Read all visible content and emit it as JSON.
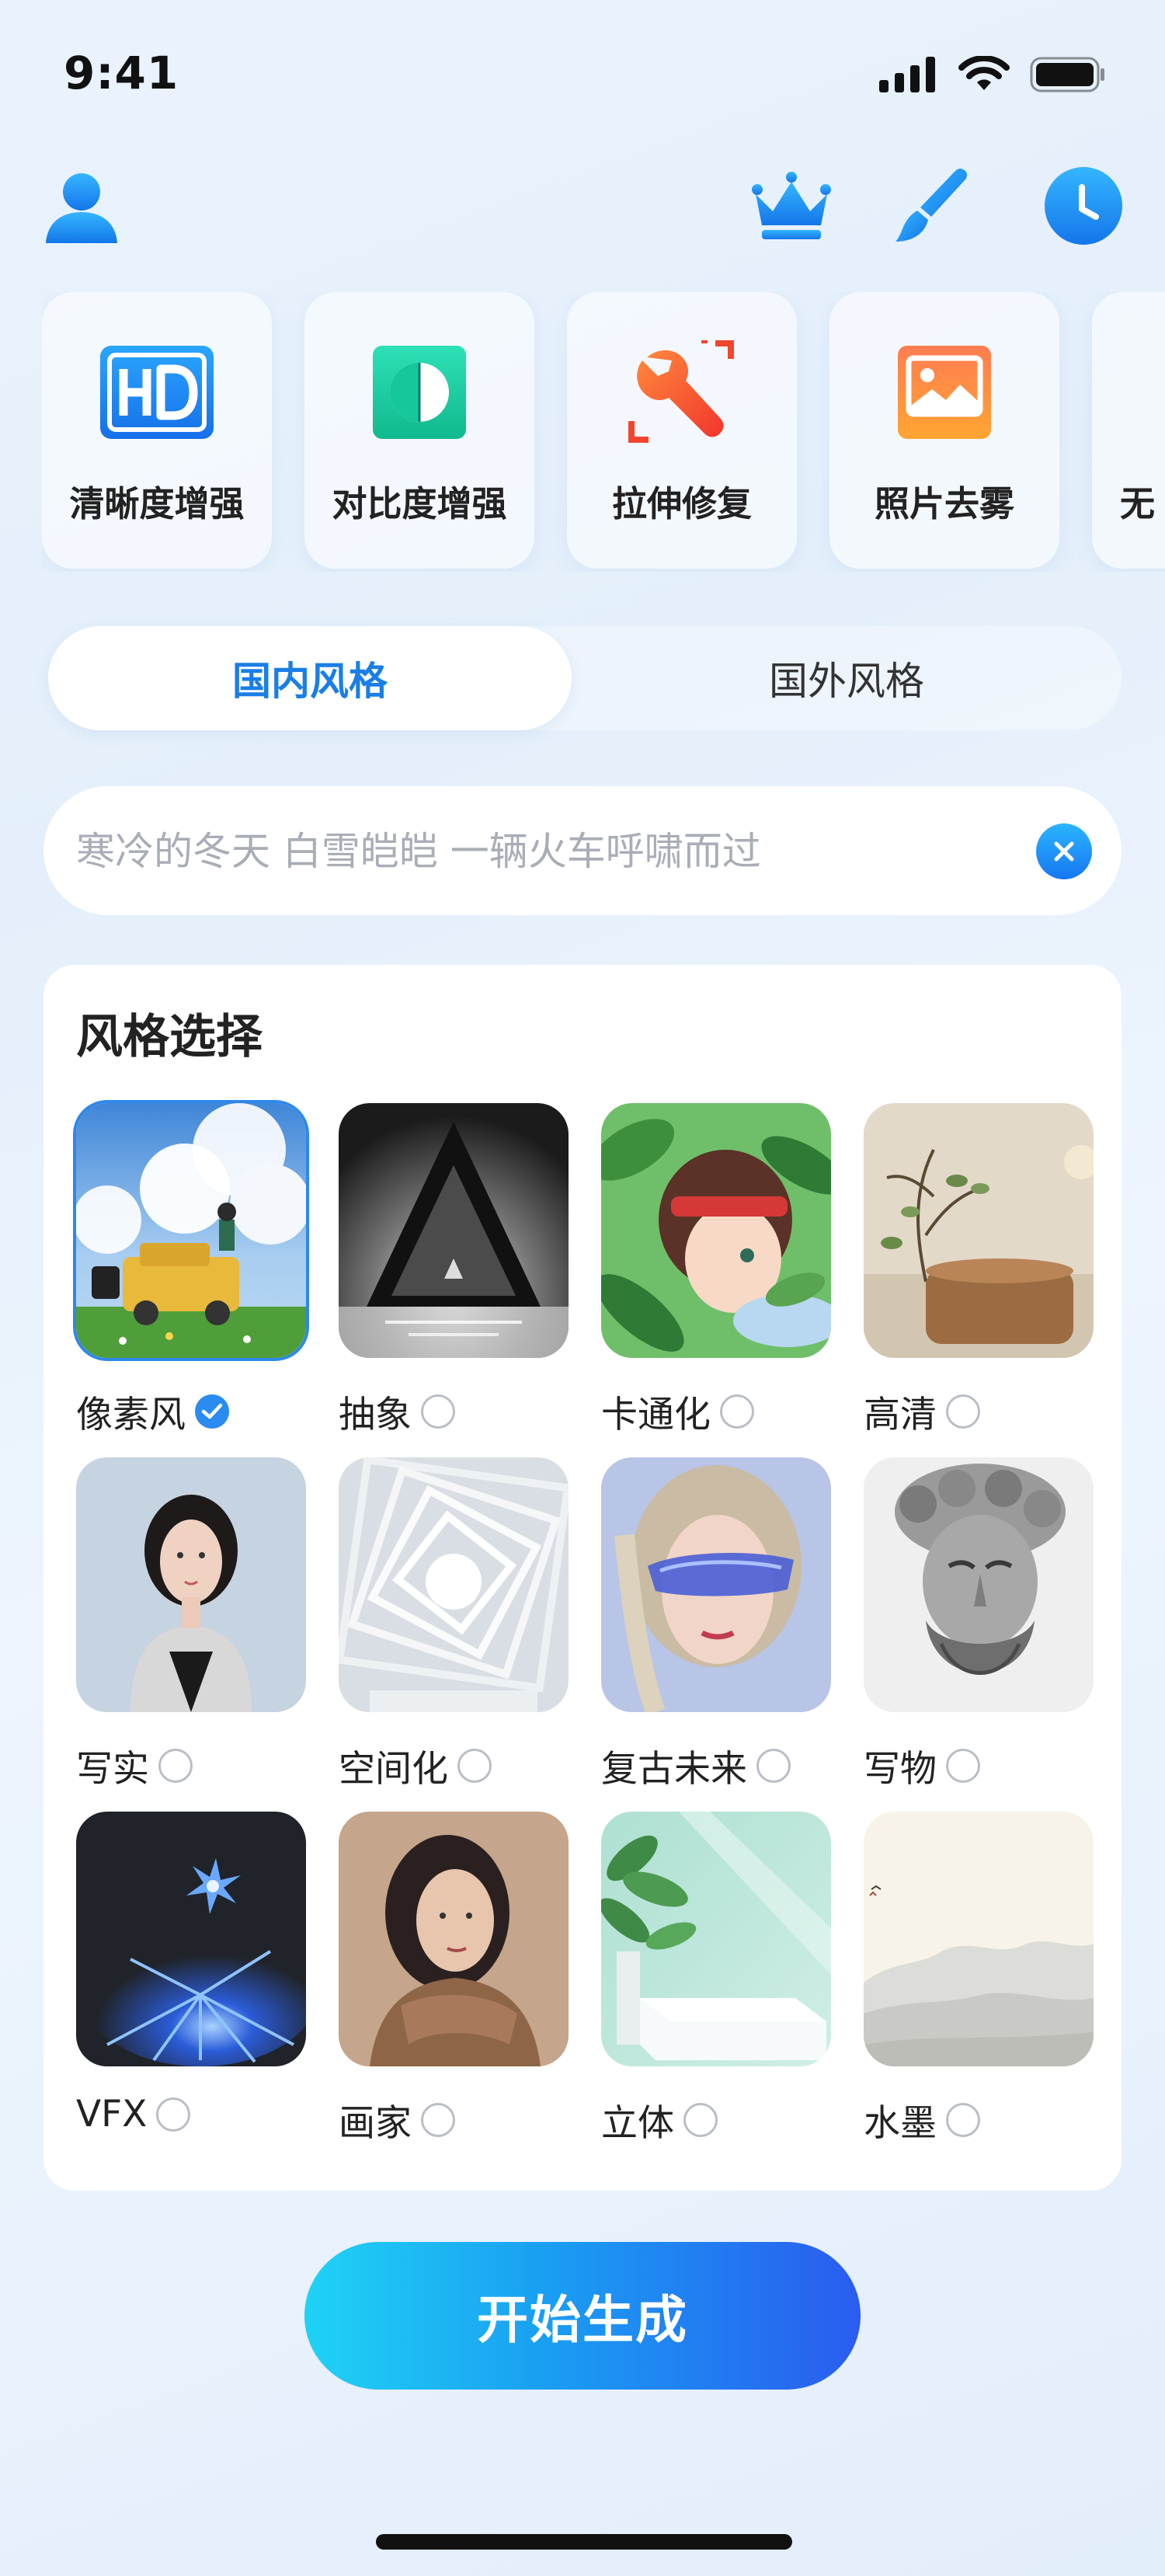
{
  "status_bar": {
    "time": "9:41"
  },
  "toolbar": {
    "profile_icon": "person-icon",
    "vip_icon": "crown-icon",
    "brush_icon": "brush-icon",
    "history_icon": "clock-icon",
    "accent": "#1a8cf0"
  },
  "tools": [
    {
      "label": "清晰度增强",
      "icon": "hd-icon"
    },
    {
      "label": "对比度增强",
      "icon": "contrast-icon"
    },
    {
      "label": "拉伸修复",
      "icon": "wrench-icon"
    },
    {
      "label": "照片去雾",
      "icon": "photo-icon"
    },
    {
      "label": "无",
      "icon": ""
    }
  ],
  "tabs": [
    {
      "label": "国内风格",
      "active": true
    },
    {
      "label": "国外风格",
      "active": false
    }
  ],
  "prompt": {
    "placeholder": "寒冷的冬天 白雪皑皑 一辆火车呼啸而过",
    "value": ""
  },
  "style_section": {
    "title": "风格选择",
    "selected": "像素风",
    "items": [
      {
        "label": "像素风",
        "selected": true
      },
      {
        "label": "抽象",
        "selected": false
      },
      {
        "label": "卡通化",
        "selected": false
      },
      {
        "label": "高清",
        "selected": false
      },
      {
        "label": "写实",
        "selected": false
      },
      {
        "label": "空间化",
        "selected": false
      },
      {
        "label": "复古未来",
        "selected": false
      },
      {
        "label": "写物",
        "selected": false
      },
      {
        "label": "VFX",
        "selected": false
      },
      {
        "label": "画家",
        "selected": false
      },
      {
        "label": "立体",
        "selected": false
      },
      {
        "label": "水墨",
        "selected": false
      }
    ]
  },
  "generate_button": {
    "label": "开始生成"
  }
}
